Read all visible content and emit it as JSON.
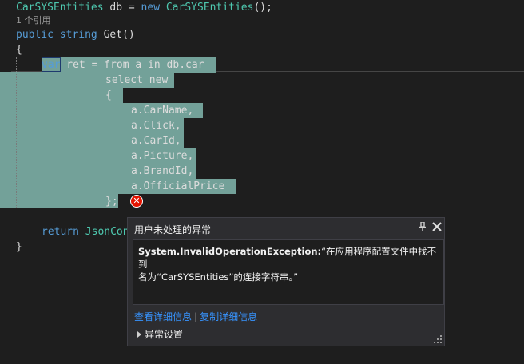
{
  "code": {
    "line1": {
      "type": "CarSYSEntities",
      "name": " db = ",
      "kw_new": "new",
      "ctor": " CarSYSEntities",
      "end": "();"
    },
    "codelens": "1 个引用",
    "line3": {
      "kw_public": "public",
      "kw_string": " string",
      "rest": " Get()"
    },
    "brace_open": "{",
    "line5": {
      "kw_var": "var",
      "rest": " ret = from a in db.car"
    },
    "select_new": "select new",
    "anon_open": "{",
    "props": [
      "a.CarName,",
      "a.Click,",
      "a.CarId,",
      "a.Picture,",
      "a.BrandId,",
      "a.OfficialPrice"
    ],
    "anon_close": "};",
    "ret": {
      "kw_return": "return",
      "rest": " JsonCon"
    },
    "brace_close": "}"
  },
  "error_icon": "error-circle-icon",
  "popup": {
    "title": "用户未处理的异常",
    "exception_type": "System.InvalidOperationException:",
    "message_line1": "“在应用程序配置文件中找不到",
    "message_line2": "名为“CarSYSEntities”的连接字符串。”",
    "link_view_detail": "查看详细信息",
    "link_copy_detail": "复制详细信息",
    "settings_label": "异常设置"
  },
  "colors": {
    "background": "#1e1e1e",
    "keyword": "#569cd6",
    "type": "#4ec9b0",
    "selection": "#73a199",
    "link": "#3794ff",
    "error": "#e51400"
  }
}
